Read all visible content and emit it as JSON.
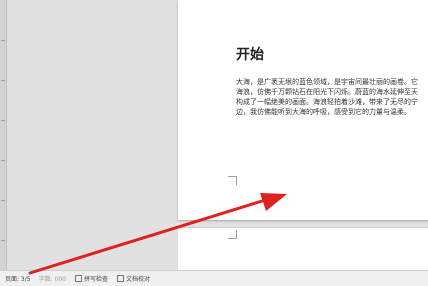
{
  "document": {
    "heading": "开始",
    "lines": [
      "大海，是广袤无垠的蓝色领域，是宇宙间最壮丽的画卷。它",
      "海浪，仿佛千万颗钻石在阳光下闪烁。蔚蓝的海水延伸至天",
      "构成了一幅绝美的画面。海浪轻拍着沙滩，带来了无尽的宁",
      "边，我仿佛能听到大海的呼吸，感受到它的力量与温柔。"
    ]
  },
  "statusbar": {
    "page": "页面: 3/5",
    "word_count": "字数: 000",
    "spell_check": "拼写检查",
    "doc_check": "文档校对"
  },
  "annotation": {
    "arrow_color": "#e02020"
  }
}
